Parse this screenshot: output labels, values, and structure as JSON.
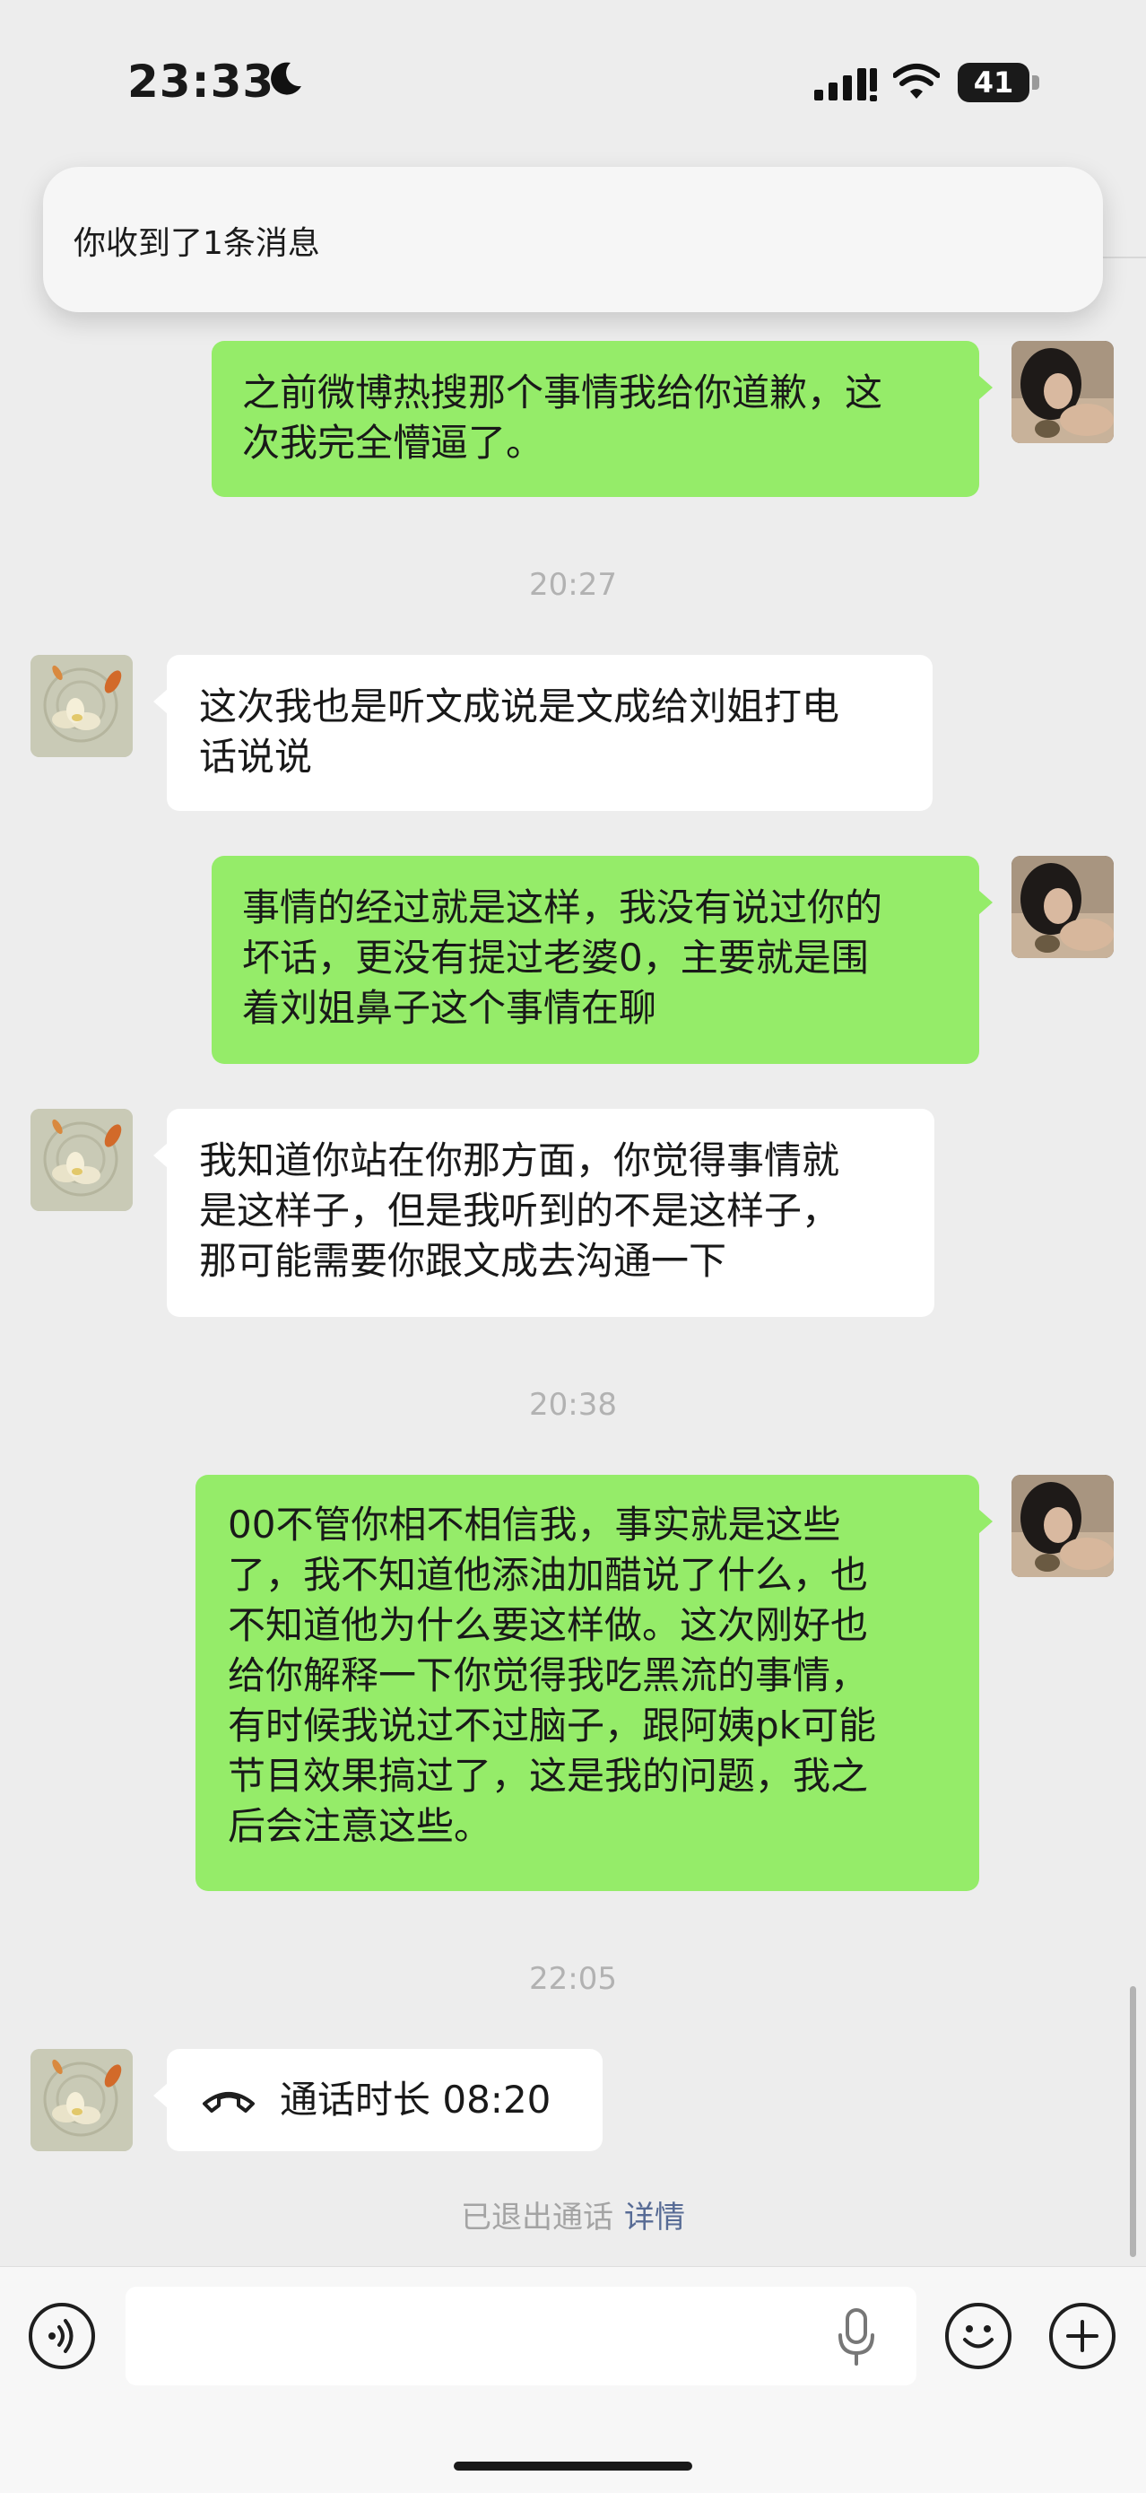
{
  "status_bar": {
    "time": "23:33",
    "battery_level": "41"
  },
  "notification": {
    "text": "你收到了1条消息"
  },
  "messages": [
    {
      "sender": "me",
      "text": "之前微博热搜那个事情我给你道歉，这\n次我完全懵逼了。"
    },
    {
      "type": "time",
      "text": "20:27"
    },
    {
      "sender": "other",
      "text": "这次我也是听文成说是文成给刘姐打电\n话说说"
    },
    {
      "sender": "me",
      "text": "事情的经过就是这样，我没有说过你的\n坏话，更没有提过老婆0，主要就是围\n着刘姐鼻子这个事情在聊"
    },
    {
      "sender": "other",
      "text": "我知道你站在你那方面，你觉得事情就\n是这样子，但是我听到的不是这样子，\n那可能需要你跟文成去沟通一下"
    },
    {
      "type": "time",
      "text": "20:38"
    },
    {
      "sender": "me",
      "text": "00不管你相不相信我，事实就是这些\n了，我不知道他添油加醋说了什么，也\n不知道他为什么要这样做。这次刚好也\n给你解释一下你觉得我吃黑流的事情，\n有时候我说过不过脑子，跟阿姨pk可能\n节目效果搞过了，这是我的问题，我之\n后会注意这些。"
    },
    {
      "type": "time",
      "text": "22:05"
    },
    {
      "sender": "other",
      "type": "call",
      "text": "通话时长 08:20"
    }
  ],
  "system_note": {
    "text": "已退出通话",
    "link": "详情"
  },
  "input_bar": {
    "value": ""
  },
  "colors": {
    "my_bubble": "#95ec69",
    "other_bubble": "#ffffff",
    "background": "#ededed",
    "link": "#576b95"
  }
}
